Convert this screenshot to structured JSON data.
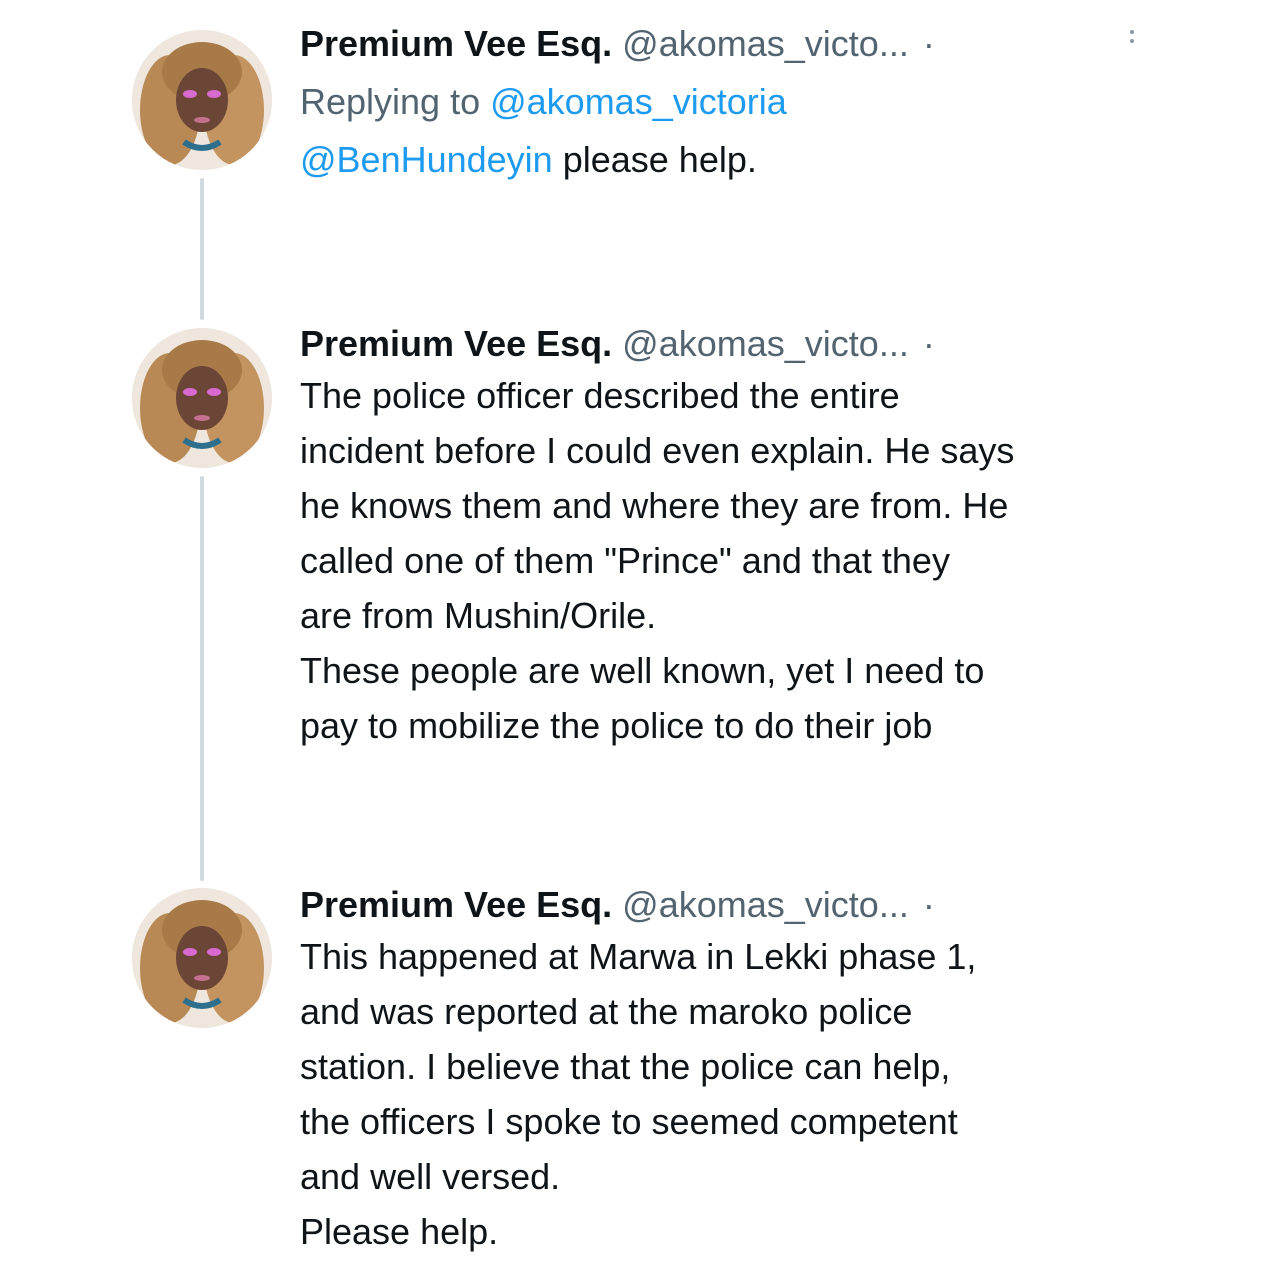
{
  "tweets": [
    {
      "name": "Premium Vee Esq.",
      "handle": "@akomas_victo...",
      "dot": "·",
      "replying_prefix": "Replying to ",
      "replying_handle": "@akomas_victoria",
      "mention": "@BenHundeyin",
      "text_after_mention": " please help."
    },
    {
      "name": "Premium Vee Esq.",
      "handle": "@akomas_victo...",
      "dot": "·",
      "lines": [
        "The police officer described the entire",
        "incident before I could even explain. He says",
        "he knows them and where they are from. He",
        "called one of them \"Prince\" and that they",
        "are from Mushin/Orile.",
        "These people are well known, yet I need to",
        "pay to mobilize the police to do their job"
      ]
    },
    {
      "name": "Premium Vee Esq.",
      "handle": "@akomas_victo...",
      "dot": "·",
      "lines": [
        "This happened at Marwa in Lekki phase 1,",
        "and was reported at the maroko police",
        "station. I believe that the police can help,",
        "the officers I spoke to seemed competent",
        "and well versed.",
        "Please help."
      ]
    }
  ],
  "icons": {
    "avatar": "profile-photo",
    "more": "more-options-icon"
  },
  "colors": {
    "mention": "#1d9bf0",
    "secondary_text": "#536471",
    "thread_line": "#cfd9de"
  }
}
